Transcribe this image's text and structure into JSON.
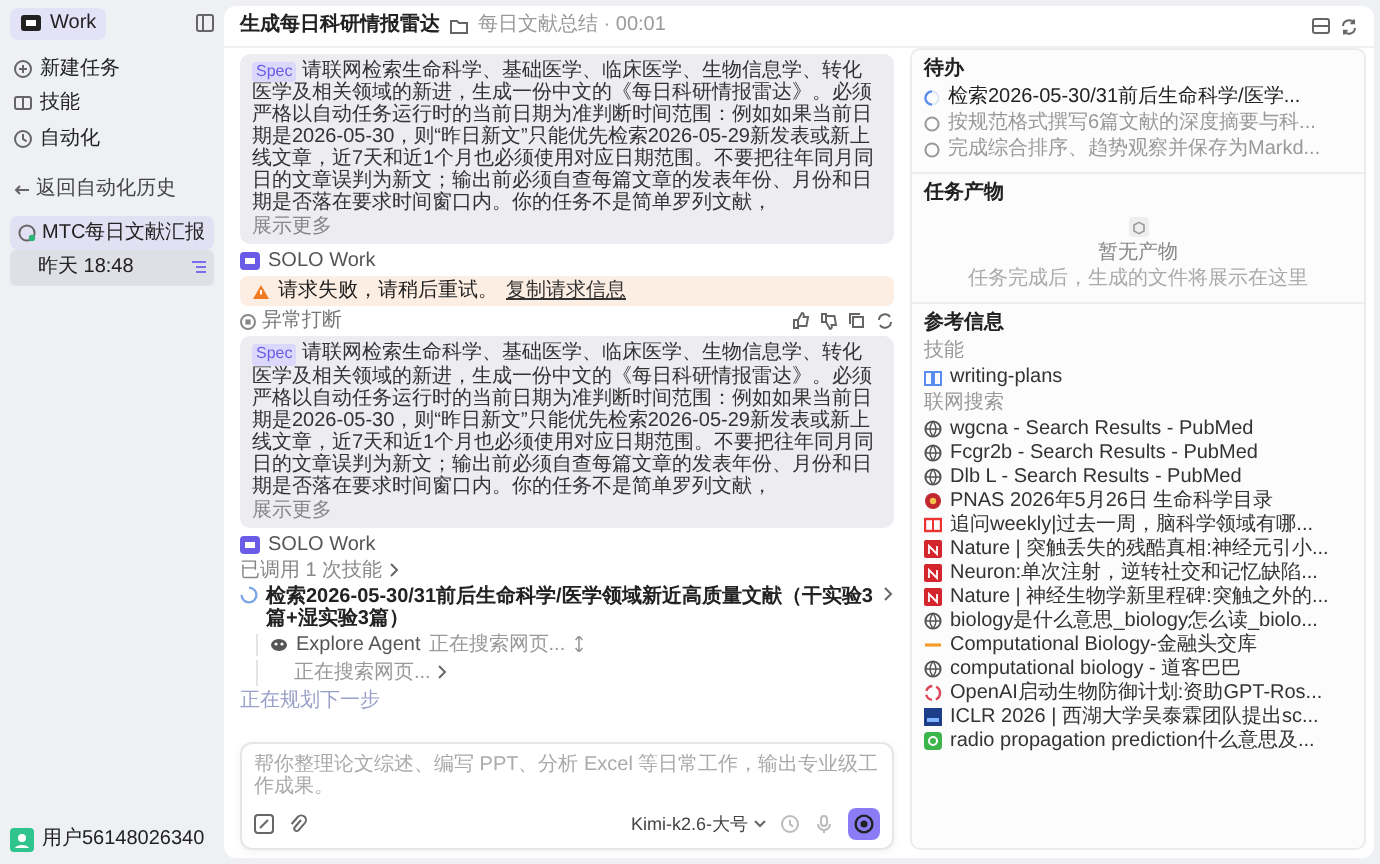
{
  "sidebar": {
    "brand": "Work",
    "nav": [
      {
        "kind": "new",
        "label": "新建任务"
      },
      {
        "kind": "skills",
        "label": "技能"
      },
      {
        "kind": "automation",
        "label": "自动化"
      }
    ],
    "back": "返回自动化历史",
    "automation": {
      "label": "MTC每日文献汇报",
      "selected": true
    },
    "runs": [
      {
        "label": "昨天 18:48",
        "selected": true
      }
    ],
    "user": "用户56148026340"
  },
  "header": {
    "title": "生成每日科研情报雷达",
    "folder": "每日文献总结 · 00:01"
  },
  "messages": [
    {
      "kind": "user",
      "tag": "Spec",
      "text": "请联网检索生命科学、基础医学、临床医学、生物信息学、转化医学及相关领域的新进，生成一份中文的《每日科研情报雷达》。必须严格以自动任务运行时的当前日期为准判断时间范围：例如如果当前日期是2026-05-30，则“昨日新文”只能优先检索2026-05-29新发表或新上线文章，近7天和近1个月也必须使用对应日期范围。不要把往年同月同日的文章误判为新文；输出前必须自查每篇文章的发表年份、月份和日期是否落在要求时间窗口内。你的任务不是简单罗列文献，",
      "more": "展示更多"
    },
    {
      "kind": "agent",
      "name": "SOLO Work"
    },
    {
      "kind": "error",
      "text": "请求失败，请稍后重试。",
      "link": "复制请求信息"
    },
    {
      "kind": "interrupted",
      "text": "异常打断"
    },
    {
      "kind": "user",
      "tag": "Spec",
      "text": "请联网检索生命科学、基础医学、临床医学、生物信息学、转化医学及相关领域的新进，生成一份中文的《每日科研情报雷达》。必须严格以自动任务运行时的当前日期为准判断时间范围：例如如果当前日期是2026-05-30，则“昨日新文”只能优先检索2026-05-29新发表或新上线文章，近7天和近1个月也必须使用对应日期范围。不要把往年同月同日的文章误判为新文；输出前必须自查每篇文章的发表年份、月份和日期是否落在要求时间窗口内。你的任务不是简单罗列文献，",
      "more": "展示更多"
    },
    {
      "kind": "agent",
      "name": "SOLO Work"
    },
    {
      "kind": "skills",
      "text": "已调用 1 次技能"
    },
    {
      "kind": "task",
      "text": "检索2026-05-30/31前后生命科学/医学领域新近高质量文献（干实验3篇+湿实验3篇）"
    },
    {
      "kind": "subagent",
      "name": "Explore Agent",
      "status": "正在搜索网页..."
    },
    {
      "kind": "step",
      "text": "正在搜索网页..."
    },
    {
      "kind": "thinking",
      "text": "正在规划下一步"
    }
  ],
  "input": {
    "placeholder": "帮你整理论文综述、编写 PPT、分析 Excel 等日常工作，输出专业级工作成果。",
    "model": "Kimi-k2.6-大号"
  },
  "todo": {
    "title": "待办",
    "items": [
      {
        "text": "检索2026-05-30/31前后生命科学/医学...",
        "active": true
      },
      {
        "text": "按规范格式撰写6篇文献的深度摘要与科...",
        "active": false
      },
      {
        "text": "完成综合排序、趋势观察并保存为Markd...",
        "active": false
      }
    ]
  },
  "artifacts": {
    "title": "任务产物",
    "empty_title": "暂无产物",
    "empty_text": "任务完成后，生成的文件将展示在这里"
  },
  "references": {
    "title": "参考信息",
    "skills_label": "技能",
    "skills": [
      "writing-plans"
    ],
    "search_label": "联网搜索",
    "search": [
      {
        "kind": "globe",
        "text": "wgcna - Search Results - PubMed"
      },
      {
        "kind": "globe",
        "text": "Fcgr2b - Search Results - PubMed"
      },
      {
        "kind": "globe",
        "text": "Dlb L - Search Results - PubMed"
      },
      {
        "kind": "red-circle",
        "text": "PNAS 2026年5月26日 生命科学目录"
      },
      {
        "kind": "red-badge",
        "text": "追问weekly|过去一周，脑科学领域有哪..."
      },
      {
        "kind": "red-square",
        "text": "Nature | 突触丢失的残酷真相:神经元引小..."
      },
      {
        "kind": "red-square",
        "text": "Neuron:单次注射，逆转社交和记忆缺陷..."
      },
      {
        "kind": "red-square",
        "text": "Nature | 神经生物学新里程碑:突触之外的..."
      },
      {
        "kind": "globe",
        "text": "biology是什么意思_biology怎么读_biolo..."
      },
      {
        "kind": "dash",
        "text": "Computational Biology-金融头交库"
      },
      {
        "kind": "globe",
        "text": "computational biology - 道客巴巴"
      },
      {
        "kind": "swirl",
        "text": "OpenAI启动生物防御计划:资助GPT-Ros..."
      },
      {
        "kind": "blue-square",
        "text": "ICLR 2026 | 西湖大学吴泰霖团队提出sc..."
      },
      {
        "kind": "green-square",
        "text": "radio propagation prediction什么意思及..."
      }
    ]
  }
}
